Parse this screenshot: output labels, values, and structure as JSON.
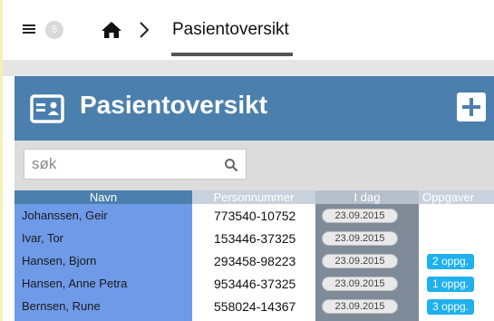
{
  "nav": {
    "menu_icon": "hamburger-icon",
    "notification_count": "5",
    "home_icon": "home-icon",
    "separator_icon": "chevron-right-icon",
    "breadcrumb_title": "Pasientoversikt"
  },
  "panel": {
    "title": "Pasientoversikt",
    "title_icon": "id-card-icon",
    "add_icon": "plus-icon",
    "header_color": "#4b7fad"
  },
  "search": {
    "placeholder": "søk",
    "value": "",
    "icon": "search-icon"
  },
  "table": {
    "headers": {
      "name": "Navn",
      "ssn": "Personnummer",
      "today": "I dag",
      "tasks": "Oppgaver"
    },
    "rows": [
      {
        "name": "Johanssen, Geir",
        "ssn": "773540-10752",
        "date": "23.09.2015",
        "tasks": ""
      },
      {
        "name": "Ivar, Tor",
        "ssn": "153446-37325",
        "date": "23.09.2015",
        "tasks": ""
      },
      {
        "name": "Hansen, Bjorn",
        "ssn": "293458-98223",
        "date": "23.09.2015",
        "tasks": "2 oppg."
      },
      {
        "name": "Hansen, Anne Petra",
        "ssn": "953446-37325",
        "date": "23.09.2015",
        "tasks": "1 oppg."
      },
      {
        "name": "Bernsen, Rune",
        "ssn": "558024-14367",
        "date": "23.09.2015",
        "tasks": "3 oppg."
      }
    ]
  },
  "colors": {
    "name_column": "#6f9ae8",
    "today_column": "#7f8b99",
    "task_badge": "#1fb0ee"
  }
}
